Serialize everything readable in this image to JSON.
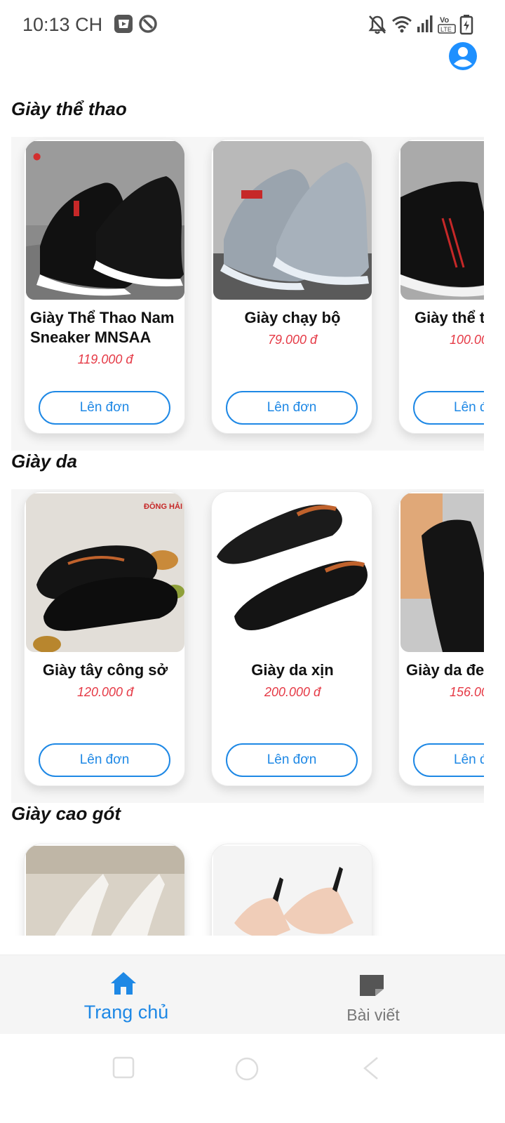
{
  "status_bar": {
    "time": "10:13 CH"
  },
  "sections": [
    {
      "title": "Giày thể thao",
      "products": [
        {
          "name": "Giày Thể Thao Nam Sneaker MNSAA",
          "price": "119.000 đ",
          "button": "Lên đơn"
        },
        {
          "name": "Giày chạy bộ",
          "price": "79.000 đ",
          "button": "Lên đơn"
        },
        {
          "name": "Giày thể t",
          "price": "100.00",
          "button": "Lên đ"
        }
      ]
    },
    {
      "title": "Giày da",
      "products": [
        {
          "name": "Giày tây công sở",
          "price": "120.000 đ",
          "button": "Lên đơn"
        },
        {
          "name": "Giày da xịn",
          "price": "200.000 đ",
          "button": "Lên đơn"
        },
        {
          "name": "Giày da đe",
          "price": "156.00",
          "button": "Lên đ"
        }
      ]
    },
    {
      "title": "Giày cao gót",
      "products": []
    }
  ],
  "tabbar": {
    "home": {
      "label": "Trang chủ",
      "active": true
    },
    "posts": {
      "label": "Bài viết",
      "active": false
    }
  },
  "colors": {
    "accent": "#1e88e5",
    "price": "#e53945",
    "tab_inactive": "#777777"
  }
}
